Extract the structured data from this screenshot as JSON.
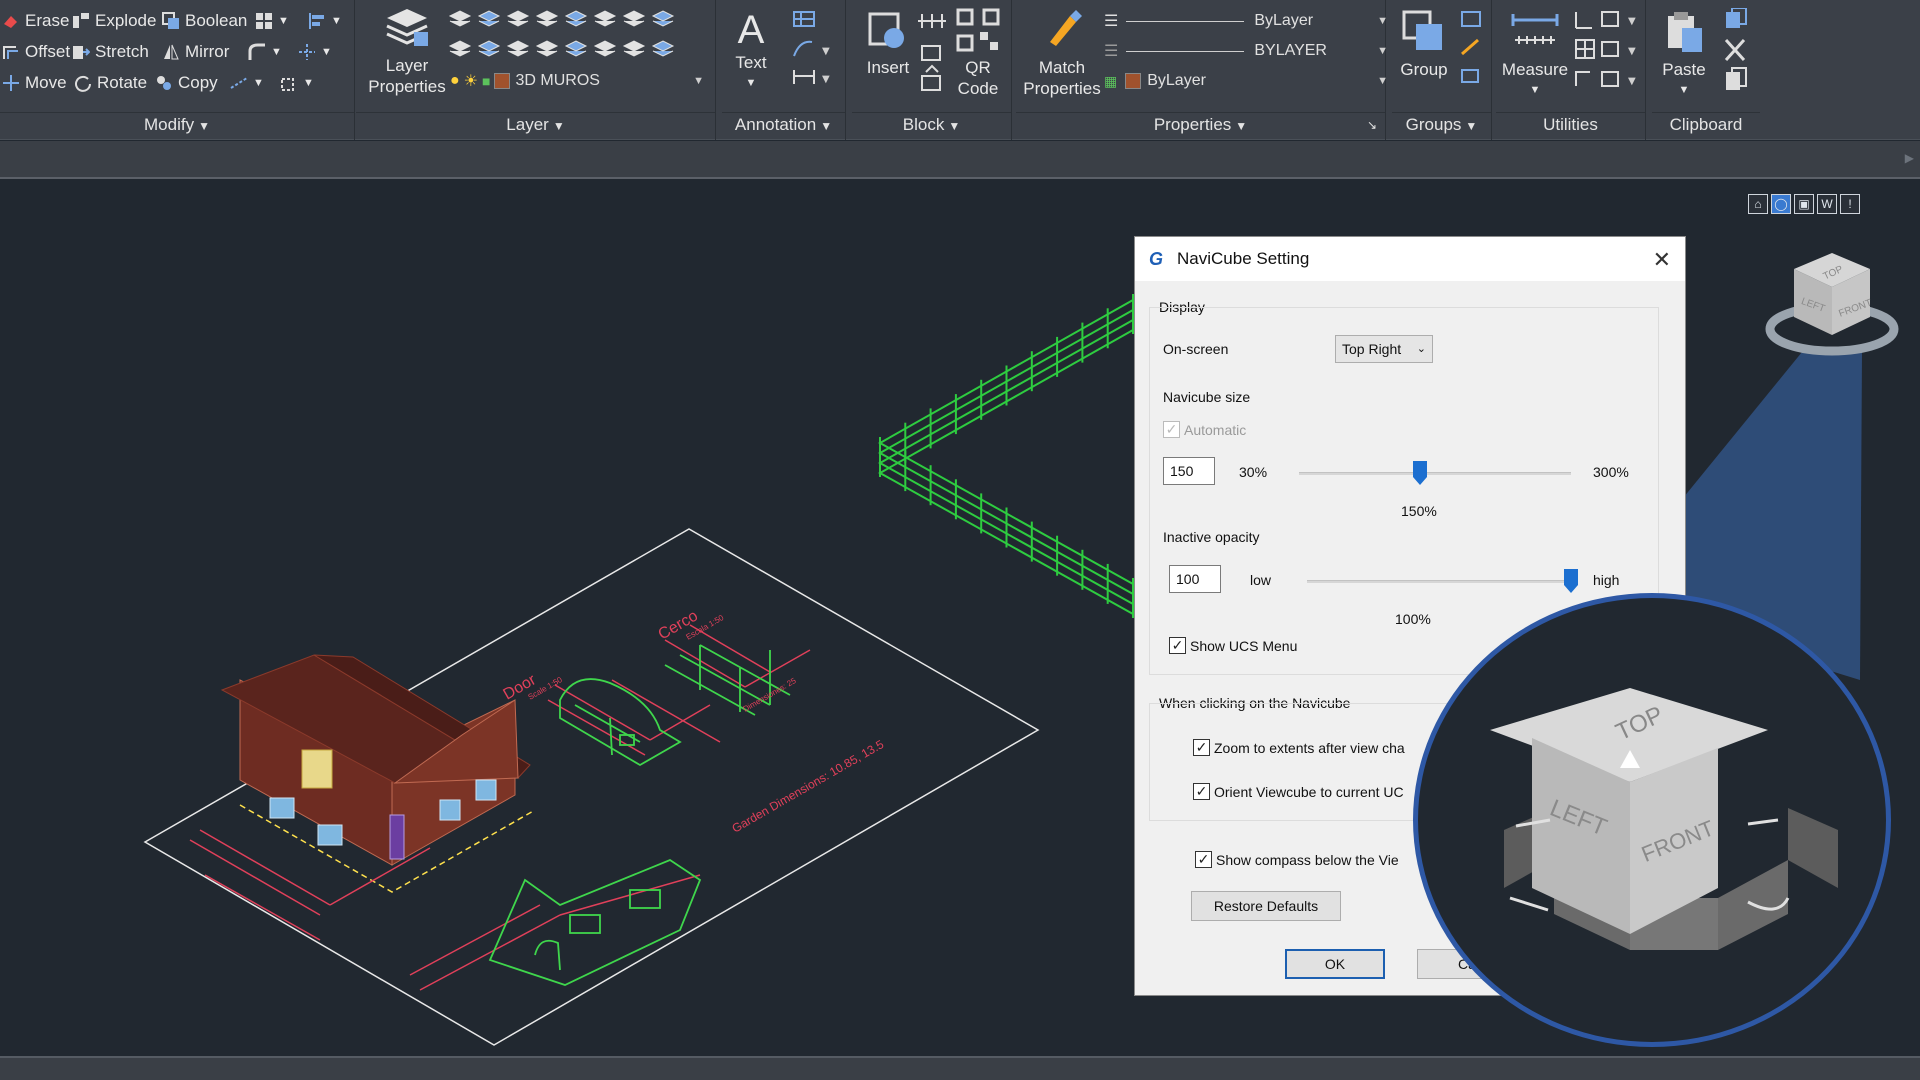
{
  "ribbon": {
    "modify": {
      "title": "Modify",
      "tools": [
        {
          "label": "Erase",
          "icon": "erase-icon"
        },
        {
          "label": "Explode",
          "icon": "explode-icon"
        },
        {
          "label": "Boolean",
          "icon": "boolean-icon"
        },
        {
          "label": "Offset",
          "icon": "offset-icon"
        },
        {
          "label": "Stretch",
          "icon": "stretch-icon"
        },
        {
          "label": "Mirror",
          "icon": "mirror-icon"
        },
        {
          "label": "Move",
          "icon": "move-icon"
        },
        {
          "label": "Rotate",
          "icon": "rotate-icon"
        },
        {
          "label": "Copy",
          "icon": "copy-icon"
        }
      ]
    },
    "layer": {
      "title": "Layer",
      "layer_properties_label": "Layer\nProperties",
      "current_layer": "3D MUROS",
      "layer_color": "#a0522d"
    },
    "annotation": {
      "title": "Annotation",
      "text_label": "Text"
    },
    "block": {
      "title": "Block",
      "insert_label": "Insert",
      "qr_label": "QR\nCode"
    },
    "properties": {
      "title": "Properties",
      "match_label": "Match\nProperties",
      "linetype": "ByLayer",
      "lineweight": "BYLAYER",
      "color": "ByLayer",
      "color_swatch": "#a0522d"
    },
    "groups": {
      "title": "Groups",
      "group_label": "Group"
    },
    "utilities": {
      "title": "Utilities",
      "measure_label": "Measure"
    },
    "clipboard": {
      "title": "Clipboard",
      "paste_label": "Paste"
    }
  },
  "navbar": {
    "wcs_label": "W"
  },
  "navicube_small": {
    "top": "TOP",
    "left": "LEFT",
    "front": "FRONT"
  },
  "drawing": {
    "door_label": "Door",
    "door_scale": "Scale 1:50",
    "fence_label": "Cerco",
    "fence_scale": "Escala 1:50",
    "fence_dims": "Dimensiones: 25",
    "garden_label": "Garden Dimensions: 10.85, 13.5"
  },
  "dialog": {
    "title": "NaviCube Setting",
    "display_group": "Display",
    "onscreen_label": "On-screen",
    "onscreen_value": "Top Right",
    "size_label": "Navicube size",
    "automatic_label": "Automatic",
    "size_value": "150",
    "size_min": "30%",
    "size_max": "300%",
    "size_percent": "150%",
    "size_fraction": 0.444,
    "opacity_label": "Inactive opacity",
    "opacity_value": "100",
    "opacity_min": "low",
    "opacity_max": "high",
    "opacity_percent": "100%",
    "opacity_fraction": 1.0,
    "show_ucs_label": "Show UCS Menu",
    "click_group": "When clicking on the Navicube",
    "zoom_extents_label": "Zoom to extents after view cha",
    "orient_label": "Orient Viewcube to current UC",
    "compass_label": "Show compass below the Vie",
    "restore_label": "Restore Defaults",
    "ok_label": "OK",
    "cancel_label": "Ca"
  },
  "navicube_zoom": {
    "top": "TOP",
    "left": "LEFT",
    "front": "FRONT"
  },
  "colors": {
    "accent": "#2e58a5",
    "fence": "#2ecc40",
    "house": "#8b3a2b",
    "plan_red": "#e0405a",
    "plan_green": "#3fd64c"
  }
}
